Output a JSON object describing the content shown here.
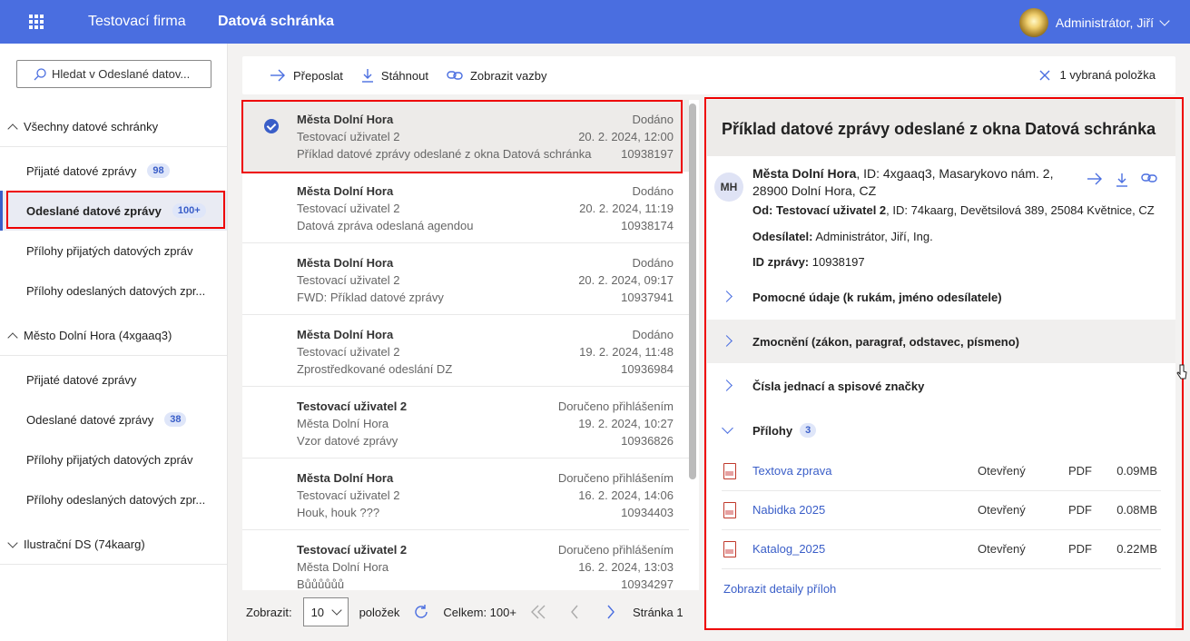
{
  "topbar": {
    "company": "Testovací firma",
    "app": "Datová schránka",
    "user": "Administrátor, Jiří"
  },
  "sidebar": {
    "search_placeholder": "Hledat v Odeslané datov...",
    "groups": [
      {
        "label": "Všechny datové schránky",
        "items": [
          {
            "label": "Přijaté datové zprávy",
            "badge": "98"
          },
          {
            "label": "Odeslané datové zprávy",
            "badge": "100+"
          },
          {
            "label": "Přílohy přijatých datových zpráv"
          },
          {
            "label": "Přílohy odeslaných datových zpr..."
          }
        ]
      },
      {
        "label": "Město Dolní Hora (4xgaaq3)",
        "items": [
          {
            "label": "Přijaté datové zprávy"
          },
          {
            "label": "Odeslané datové zprávy",
            "badge": "38"
          },
          {
            "label": "Přílohy přijatých datových zpráv"
          },
          {
            "label": "Přílohy odeslaných datových zpr..."
          }
        ]
      },
      {
        "label": "Ilustrační DS (74kaarg)"
      }
    ]
  },
  "toolbar": {
    "forward": "Přeposlat",
    "download": "Stáhnout",
    "links": "Zobrazit vazby",
    "selected": "1 vybraná položka"
  },
  "messages": [
    {
      "sender": "Města Dolní Hora",
      "user": "Testovací uživatel 2",
      "subject": "Příklad datové zprávy odeslané z okna Datová schránka",
      "status": "Dodáno",
      "date": "20. 2. 2024, 12:00",
      "id": "10938197"
    },
    {
      "sender": "Města Dolní Hora",
      "user": "Testovací uživatel 2",
      "subject": "Datová zpráva odeslaná agendou",
      "status": "Dodáno",
      "date": "20. 2. 2024, 11:19",
      "id": "10938174"
    },
    {
      "sender": "Města Dolní Hora",
      "user": "Testovací uživatel 2",
      "subject": "FWD: Příklad datové zprávy",
      "status": "Dodáno",
      "date": "20. 2. 2024, 09:17",
      "id": "10937941"
    },
    {
      "sender": "Města Dolní Hora",
      "user": "Testovací uživatel 2",
      "subject": "Zprostředkované odeslání DZ",
      "status": "Dodáno",
      "date": "19. 2. 2024, 11:48",
      "id": "10936984"
    },
    {
      "sender": "Testovací uživatel 2",
      "user": "Města Dolní Hora",
      "subject": "Vzor datové zprávy",
      "status": "Doručeno přihlášením",
      "date": "19. 2. 2024, 10:27",
      "id": "10936826"
    },
    {
      "sender": "Města Dolní Hora",
      "user": "Testovací uživatel 2",
      "subject": "Houk, houk ???",
      "status": "Doručeno přihlášením",
      "date": "16. 2. 2024, 14:06",
      "id": "10934403"
    },
    {
      "sender": "Testovací uživatel 2",
      "user": "Města Dolní Hora",
      "subject": "Bůůůůůů",
      "status": "Doručeno přihlášením",
      "date": "16. 2. 2024, 13:03",
      "id": "10934297"
    }
  ],
  "pager": {
    "show_label": "Zobrazit:",
    "page_size": "10",
    "items_label": "položek",
    "total": "Celkem: 100+",
    "page": "Stránka 1"
  },
  "detail": {
    "title": "Příklad datové zprávy odeslané z okna Datová schránka",
    "avatar": "MH",
    "from_name": "Města Dolní Hora",
    "from_rest": ", ID: 4xgaaq3, Masarykovo nám. 2, 28900 Dolní Hora, CZ",
    "to_label": "Od:",
    "to_name": "Testovací uživatel 2",
    "to_rest": ", ID: 74kaarg, Devětsilová 389, 25084 Květnice, CZ",
    "sender_label": "Odesílatel:",
    "sender_value": "Administrátor, Jiří, Ing.",
    "id_label": "ID zprávy:",
    "id_value": "10938197",
    "sections": [
      "Pomocné údaje (k rukám, jméno odesílatele)",
      "Zmocnění (zákon, paragraf, odstavec, písmeno)",
      "Čísla jednací a spisové značky"
    ],
    "attachments_label": "Přílohy",
    "attachments_count": "3",
    "attachments": [
      {
        "name": "Textova zprava",
        "state": "Otevřený",
        "type": "PDF",
        "size": "0.09MB"
      },
      {
        "name": "Nabidka 2025",
        "state": "Otevřený",
        "type": "PDF",
        "size": "0.08MB"
      },
      {
        "name": "Katalog_2025",
        "state": "Otevřený",
        "type": "PDF",
        "size": "0.22MB"
      }
    ],
    "more_link": "Zobrazit detaily příloh"
  },
  "colors": {
    "accent": "#4a6ee0",
    "highlight": "#ee0000"
  }
}
